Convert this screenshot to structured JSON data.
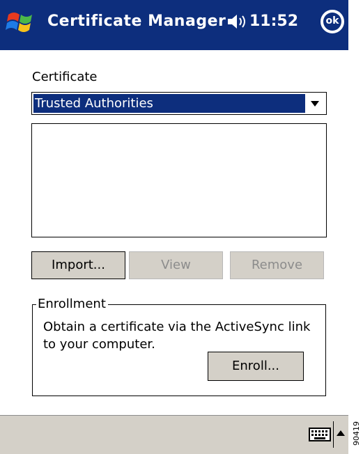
{
  "titlebar": {
    "app_title": "Certificate Manager",
    "time": "11:52",
    "ok_label": "ok",
    "start_icon": "windows-flag-icon",
    "volume_icon": "speaker-icon",
    "background": "#0d2e7d"
  },
  "form": {
    "certificate_label": "Certificate",
    "certificate_selected": "Trusted Authorities",
    "certificate_list_items": []
  },
  "buttons": {
    "import_label": "Import...",
    "view_label": "View",
    "remove_label": "Remove",
    "view_enabled": false,
    "remove_enabled": false
  },
  "enrollment": {
    "legend": "Enrollment",
    "description": "Obtain a certificate via the ActiveSync link to your computer.",
    "enroll_label": "Enroll..."
  },
  "menubar": {
    "keyboard_icon": "keyboard-icon",
    "input_menu_icon": "caret-up-icon"
  },
  "figure_id": "90419"
}
